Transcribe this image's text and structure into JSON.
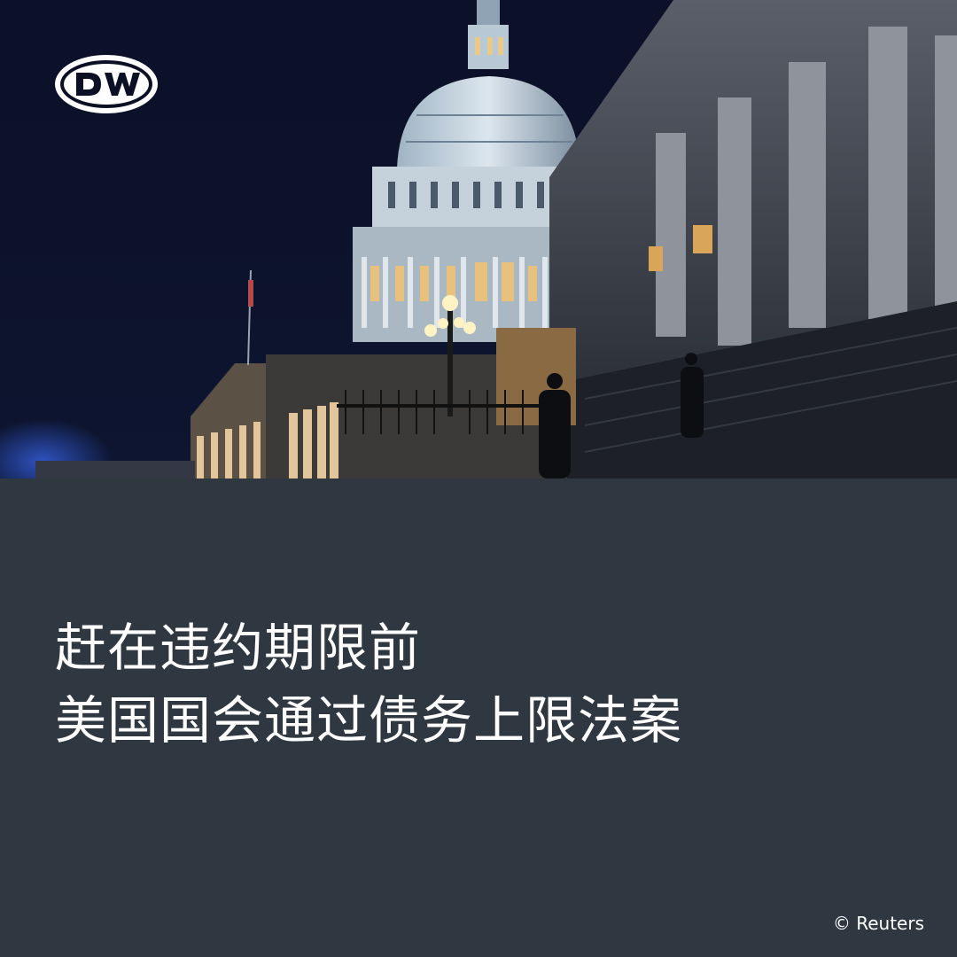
{
  "image": {
    "subject": "capitol-dome-night-photo",
    "logo_text": "DW"
  },
  "headline": {
    "line1": "赶在违约期限前",
    "line2": "美国国会通过债务上限法案"
  },
  "credit": "© Reuters",
  "colors": {
    "panel": "#2f3841",
    "sky": "#0a0f24",
    "text": "#ffffff"
  }
}
